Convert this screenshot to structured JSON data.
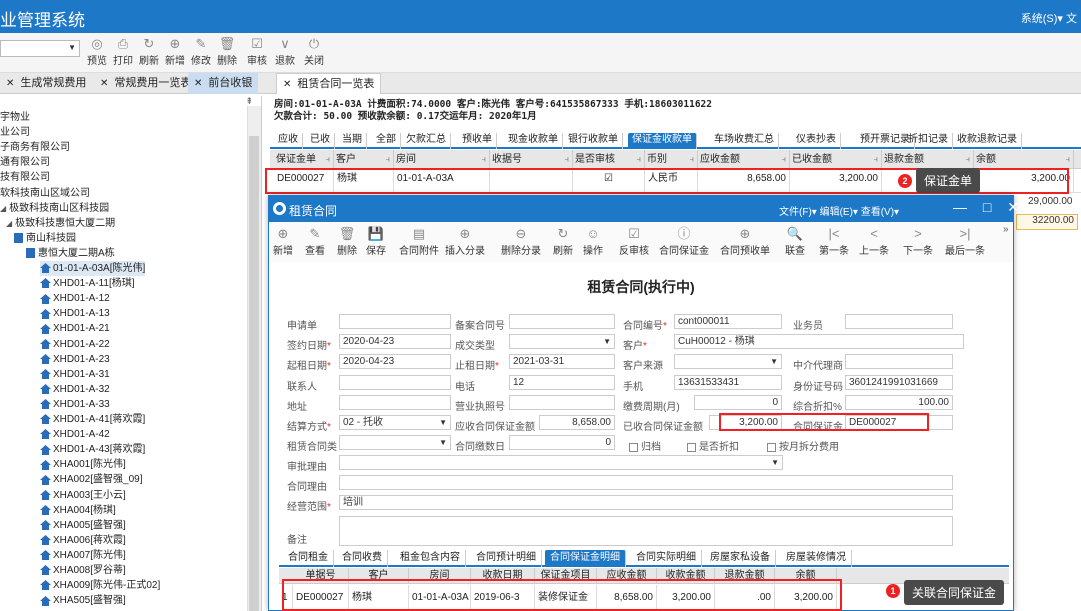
{
  "app": {
    "title": "业管理系统",
    "top_right": "系统(S)▾ 文"
  },
  "toolbar": {
    "buttons": [
      {
        "label": "预览",
        "icon": "eye-icon",
        "glyph": "◎"
      },
      {
        "label": "打印",
        "icon": "print-icon",
        "glyph": "⎙"
      },
      {
        "label": "刷新",
        "icon": "refresh-icon",
        "glyph": "↻"
      },
      {
        "label": "新增",
        "icon": "add-icon",
        "glyph": "⊕"
      },
      {
        "label": "修改",
        "icon": "edit-icon",
        "glyph": "✎"
      },
      {
        "label": "删除",
        "icon": "delete-icon",
        "glyph": "🗑"
      },
      {
        "label": "审核",
        "icon": "check-icon",
        "glyph": "☑"
      },
      {
        "label": "退款",
        "icon": "chevron-icon",
        "glyph": "∨"
      },
      {
        "label": "关闭",
        "icon": "power-icon",
        "glyph": "⏻"
      }
    ]
  },
  "tabs": [
    "生成常规费用",
    "常规费用一览表",
    "前台收银",
    "租赁合同一览表"
  ],
  "tree": [
    "宇物业",
    "业公司",
    "子商务有限公司",
    "通有限公司",
    "技有限公司",
    "软科技南山区域公司",
    "极致科技南山区科技园",
    "极致科技惠恒大厦二期",
    "南山科技园",
    "惠恒大厦二期A栋",
    "01-01-A-03A[陈光伟]",
    "XHD01-A-11[杨琪]",
    "XHD01-A-12",
    "XHD01-A-13",
    "XHD01-A-21",
    "XHD01-A-22",
    "XHD01-A-23",
    "XHD01-A-31",
    "XHD01-A-32",
    "XHD01-A-33",
    "XHD01-A-41[蒋欢霞]",
    "XHD01-A-42",
    "XHD01-A-43[蒋欢霞]",
    "XHA001[陈光伟]",
    "XHA002[盛智强_09]",
    "XHA003[王小云]",
    "XHA004[杨琪]",
    "XHA005[盛智强]",
    "XHA006[蒋欢霞]",
    "XHA007[陈光伟]",
    "XHA008[罗谷蒂]",
    "XHA009[陈光伟-正式02]",
    "XHA505[盛智强]"
  ],
  "info": {
    "line1": "房间:01-01-A-03A 计费面积:74.0000 客户:陈光伟 客户号:641535867333 手机:18603011622",
    "line2": "欠款合计: 50.00 预收款余额: 0.17交运年月: 2020年1月"
  },
  "subtabs": [
    "应收",
    "已收",
    "当期",
    "全部",
    "欠款汇总",
    "预收单",
    "现金收款单",
    "银行收款单",
    "保证金收款单",
    "车场收费汇总",
    "仪表抄表",
    "预开票记录",
    "折扣记录",
    "收款退款记录"
  ],
  "grid": {
    "headers": [
      "保证金单",
      "客户",
      "房间",
      "收据号",
      "是否审核",
      "币别",
      "应收金额",
      "已收金额",
      "退款金额",
      "余额"
    ],
    "row": [
      "DE000027",
      "杨琪",
      "01-01-A-03A",
      "",
      "☑",
      "人民币",
      "8,658.00",
      "3,200.00",
      "",
      "3,200.00"
    ],
    "extra": [
      "29,000.00",
      "32200.00"
    ]
  },
  "annotation2": {
    "num": "2",
    "text": "保证金单"
  },
  "modal": {
    "title": "租赁合同",
    "menu": "文件(F)▾  编辑(E)▾  查看(V)▾",
    "win": "— □ ✕",
    "toolbar": [
      "新增",
      "查看",
      "删除",
      "保存",
      "合同附件",
      "插入分录",
      "删除分录",
      "刷新",
      "操作",
      "反审核",
      "合同保证金",
      "合同预收单",
      "联查",
      "第一条",
      "上一条",
      "下一条",
      "最后一条"
    ],
    "toolbar_icons": [
      "⊕",
      "✎",
      "🗑",
      "💾",
      "▤",
      "⊕",
      "⊖",
      "↻",
      "☺",
      "☑",
      "ⓘ",
      "⊕",
      "🔍",
      "|<",
      "<",
      ">",
      ">|"
    ],
    "heading": "租赁合同(执行中)",
    "fields": {
      "申请单": "",
      "备案合同号": "",
      "合同编号": "cont000011",
      "业务员": "",
      "签约日期": "2020-04-23",
      "成交类型": "",
      "客户": "CuH00012 - 杨琪",
      "起租日期": "2020-04-23",
      "止租日期": "2021-03-31",
      "客户来源": "",
      "中介代理商": "",
      "联系人": "",
      "电话": "12",
      "手机": "13631533431",
      "身份证号码": "3601241991031669",
      "地址": "",
      "营业执照号": "",
      "缴费周期(月)": "0",
      "综合折扣%": "100.00",
      "结算方式": "02 - 托收",
      "应收合同保证金额": "8,658.00",
      "已收合同保证金额": "3,200.00",
      "合同保证金": "DE000027",
      "租赁合同类型": "",
      "合同缴数日": "0",
      "归档": "归档",
      "是否折扣": "是否折扣",
      "按月拆分费用": "按月拆分费用",
      "审批理由": "",
      "合同理由": "",
      "经营范围": "培训",
      "备注": ""
    },
    "labels": {
      "申请单": "申请单",
      "备案合同号": "备案合同号",
      "合同编号": "合同编号",
      "业务员": "业务员",
      "签约日期": "签约日期",
      "成交类型": "成交类型",
      "客户": "客户",
      "起租日期": "起租日期",
      "止租日期": "止租日期",
      "客户来源": "客户来源",
      "中介代理商": "中介代理商",
      "联系人": "联系人",
      "电话": "电话",
      "手机": "手机",
      "身份证号码": "身份证号码",
      "地址": "地址",
      "营业执照号": "营业执照号",
      "缴费周期": "缴费周期(月)",
      "综合折扣": "综合折扣%",
      "结算方式": "结算方式",
      "应收合同保证金额": "应收合同保证金额",
      "已收合同保证金额": "已收合同保证金额",
      "合同保证金": "合同保证金",
      "租赁合同类型": "租赁合同类",
      "合同缴数日": "合同缴数日",
      "审批理由": "审批理由",
      "合同理由": "合同理由",
      "经营范围": "经营范围",
      "备注": "备注"
    },
    "dtabs": [
      "合同租金",
      "合同收费",
      "租金包含内容",
      "合同预计明细",
      "合同保证金明细",
      "合同实际明细",
      "房屋家私设备",
      "房屋装修情况"
    ],
    "dheaders": [
      "单据号",
      "客户",
      "房间",
      "收款日期",
      "保证金项目",
      "应收金额",
      "收款金额",
      "退款金额",
      "余额"
    ],
    "drow": [
      "1",
      "DE000027",
      "杨琪",
      "01-01-A-03A",
      "2019-06-3",
      "装修保证金",
      "8,658.00",
      "3,200.00",
      ".00",
      "3,200.00"
    ]
  },
  "annotation1": {
    "num": "1",
    "text": "关联合同保证金"
  },
  "colors": {
    "accent": "#1e78c8",
    "highlight": "#e22222"
  }
}
